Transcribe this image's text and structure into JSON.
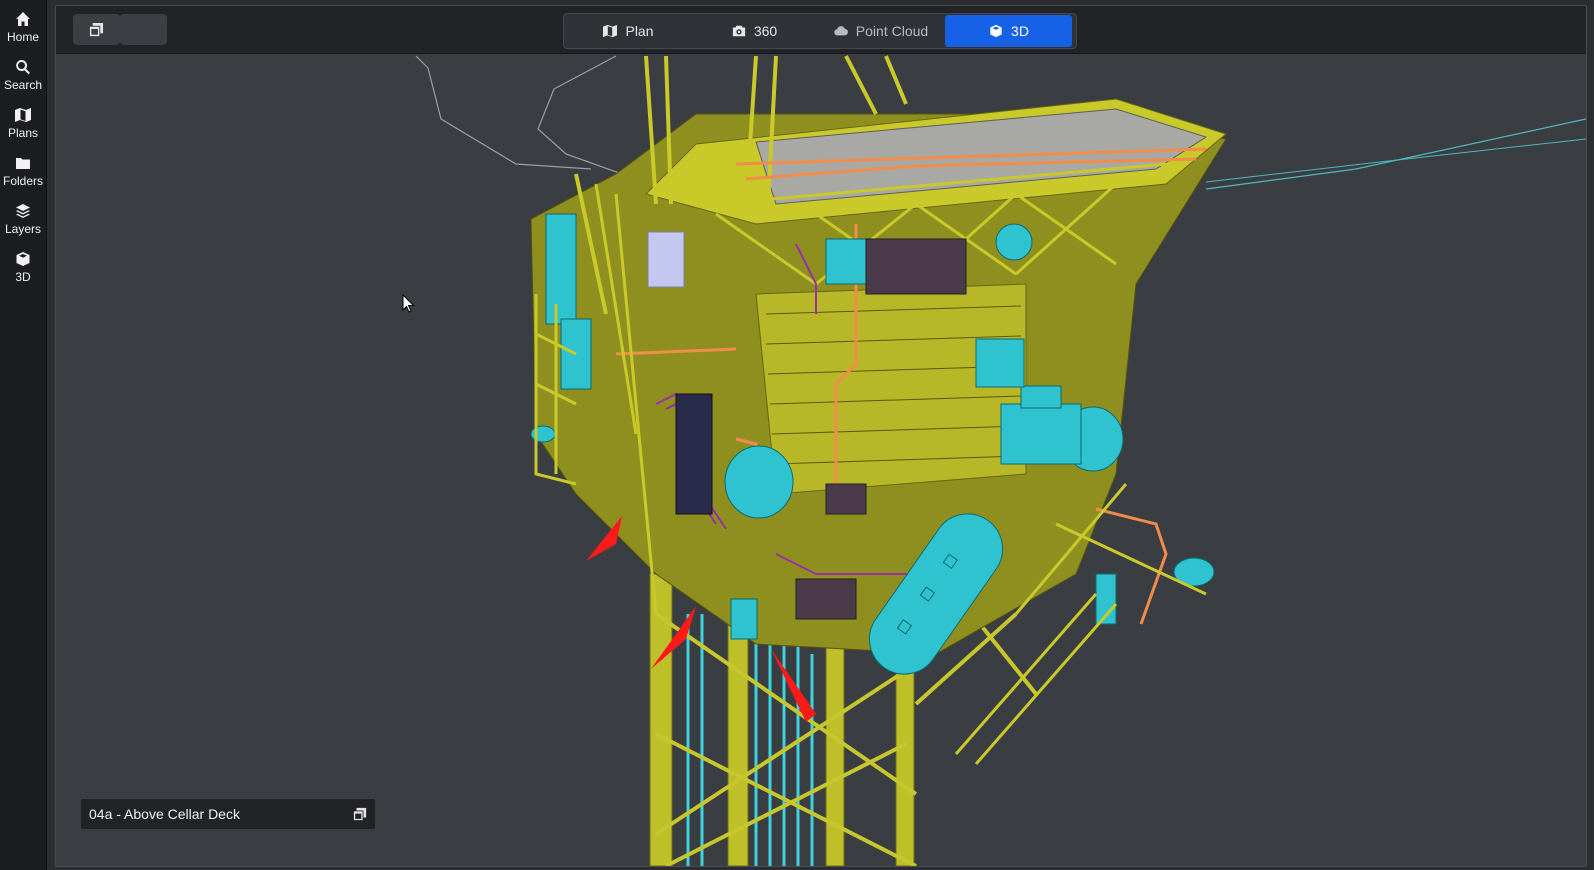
{
  "sidebar": {
    "items": [
      {
        "label": "Home",
        "icon": "home-icon"
      },
      {
        "label": "Search",
        "icon": "search-icon"
      },
      {
        "label": "Plans",
        "icon": "map-icon"
      },
      {
        "label": "Folders",
        "icon": "folder-icon"
      },
      {
        "label": "Layers",
        "icon": "layers-icon"
      },
      {
        "label": "3D",
        "icon": "cube-icon"
      }
    ]
  },
  "toolbar": {
    "left_buttons": [
      {
        "icon": "window-restore-icon"
      },
      {
        "icon": ""
      }
    ],
    "view_tabs": [
      {
        "label": "Plan",
        "icon": "map-icon",
        "state": "normal"
      },
      {
        "label": "360",
        "icon": "camera-icon",
        "state": "normal"
      },
      {
        "label": "Point Cloud",
        "icon": "cloud-icon",
        "state": "dim"
      },
      {
        "label": "3D",
        "icon": "cube-icon",
        "state": "active"
      }
    ]
  },
  "viewport": {
    "level_label": "04a - Above Cellar Deck",
    "level_icon": "window-restore-icon",
    "colors": {
      "background": "#3a3d41",
      "structure": "#c9c92a",
      "equipment": "#2fc3cf",
      "piping": "#f28c4a",
      "cables": "#9a2fa8",
      "markers": "#ff1a1a"
    }
  },
  "accent_color": "#1661e6"
}
